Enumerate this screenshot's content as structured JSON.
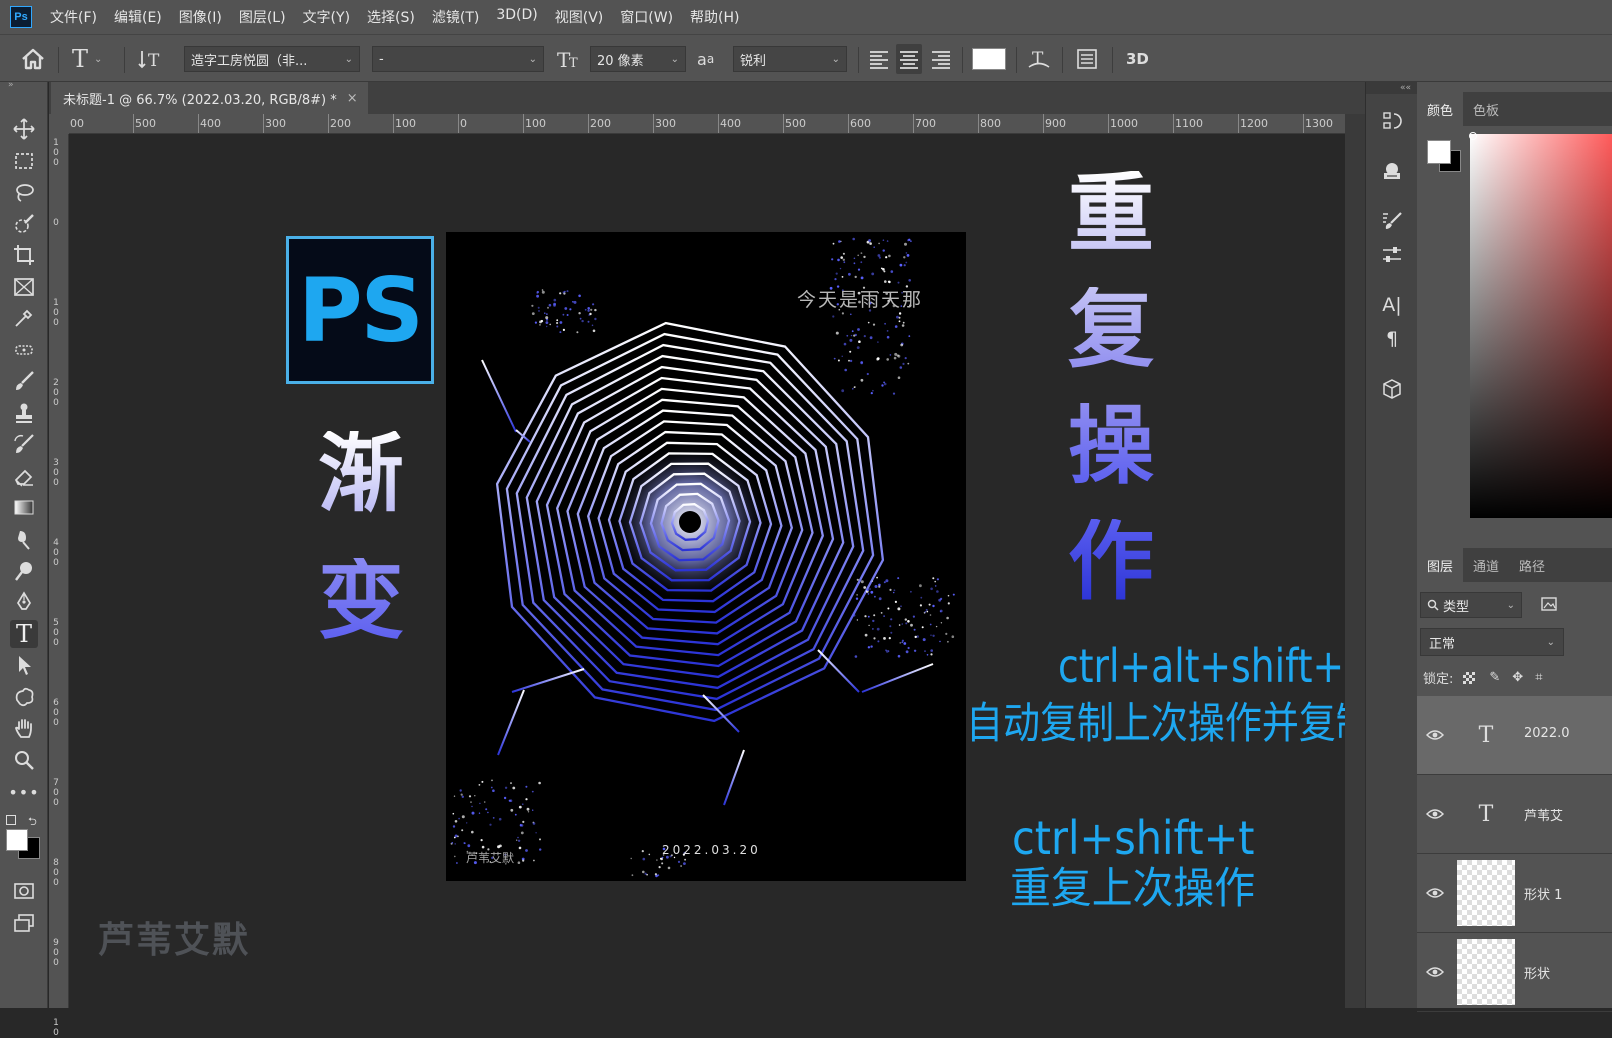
{
  "app": {
    "logo": "Ps",
    "menu": [
      "文件(F)",
      "编辑(E)",
      "图像(I)",
      "图层(L)",
      "文字(Y)",
      "选择(S)",
      "滤镜(T)",
      "3D(D)",
      "视图(V)",
      "窗口(W)",
      "帮助(H)"
    ]
  },
  "options": {
    "font_family": "造字工房悦圆（非...",
    "font_style": "-",
    "font_size": "20 像素",
    "aa_label": "a",
    "aa_mode": "锐利",
    "threed_label": "3D",
    "text_color": "#ffffff"
  },
  "document": {
    "tab_title": "未标题-1 @ 66.7% (2022.03.20, RGB/8#) *",
    "close": "×"
  },
  "ruler": {
    "h_labels": [
      "00",
      "500",
      "400",
      "300",
      "200",
      "100",
      "0",
      "100",
      "200",
      "300",
      "400",
      "500",
      "600",
      "700",
      "800",
      "900",
      "1000",
      "1100",
      "1200",
      "1300"
    ],
    "v_labels": [
      "1\n0\n0",
      "0",
      "1\n0\n0",
      "2\n0\n0",
      "3\n0\n0",
      "4\n0\n0",
      "5\n0\n0",
      "6\n0\n0",
      "7\n0\n0",
      "8\n0\n0",
      "9\n0\n0",
      "1\n0"
    ]
  },
  "artwork": {
    "ps_badge": "PS",
    "left_chars": [
      "渐",
      "变"
    ],
    "right_chars": [
      "重",
      "复",
      "操",
      "作"
    ],
    "poster_title": "今天是雨天那",
    "poster_date": "2022.03.20",
    "poster_signature": "芦苇艾默",
    "shortcut1_keys": "ctrl+alt+shift+t",
    "shortcut1_desc": "自动复制上次操作并复制图层",
    "shortcut2_keys": "ctrl+shift+t",
    "shortcut2_desc": "重复上次操作",
    "watermark": "芦苇艾默",
    "colors": {
      "accent": "#1ea7f0",
      "gradient_light": "#eef0ff",
      "gradient_dark": "#2b33d6"
    }
  },
  "panels": {
    "color_tabs": [
      "颜色",
      "色板"
    ],
    "layer_tabs": [
      "图层",
      "通道",
      "路径"
    ],
    "filter_label": "类型",
    "blend_mode": "正常",
    "lock_label": "锁定:",
    "layers": [
      {
        "name": "2022.0",
        "type": "text",
        "selected": true
      },
      {
        "name": "芦苇艾",
        "type": "text",
        "selected": false
      },
      {
        "name": "形状 1",
        "type": "shape",
        "selected": false
      },
      {
        "name": "形状",
        "type": "shape",
        "selected": false
      }
    ]
  }
}
